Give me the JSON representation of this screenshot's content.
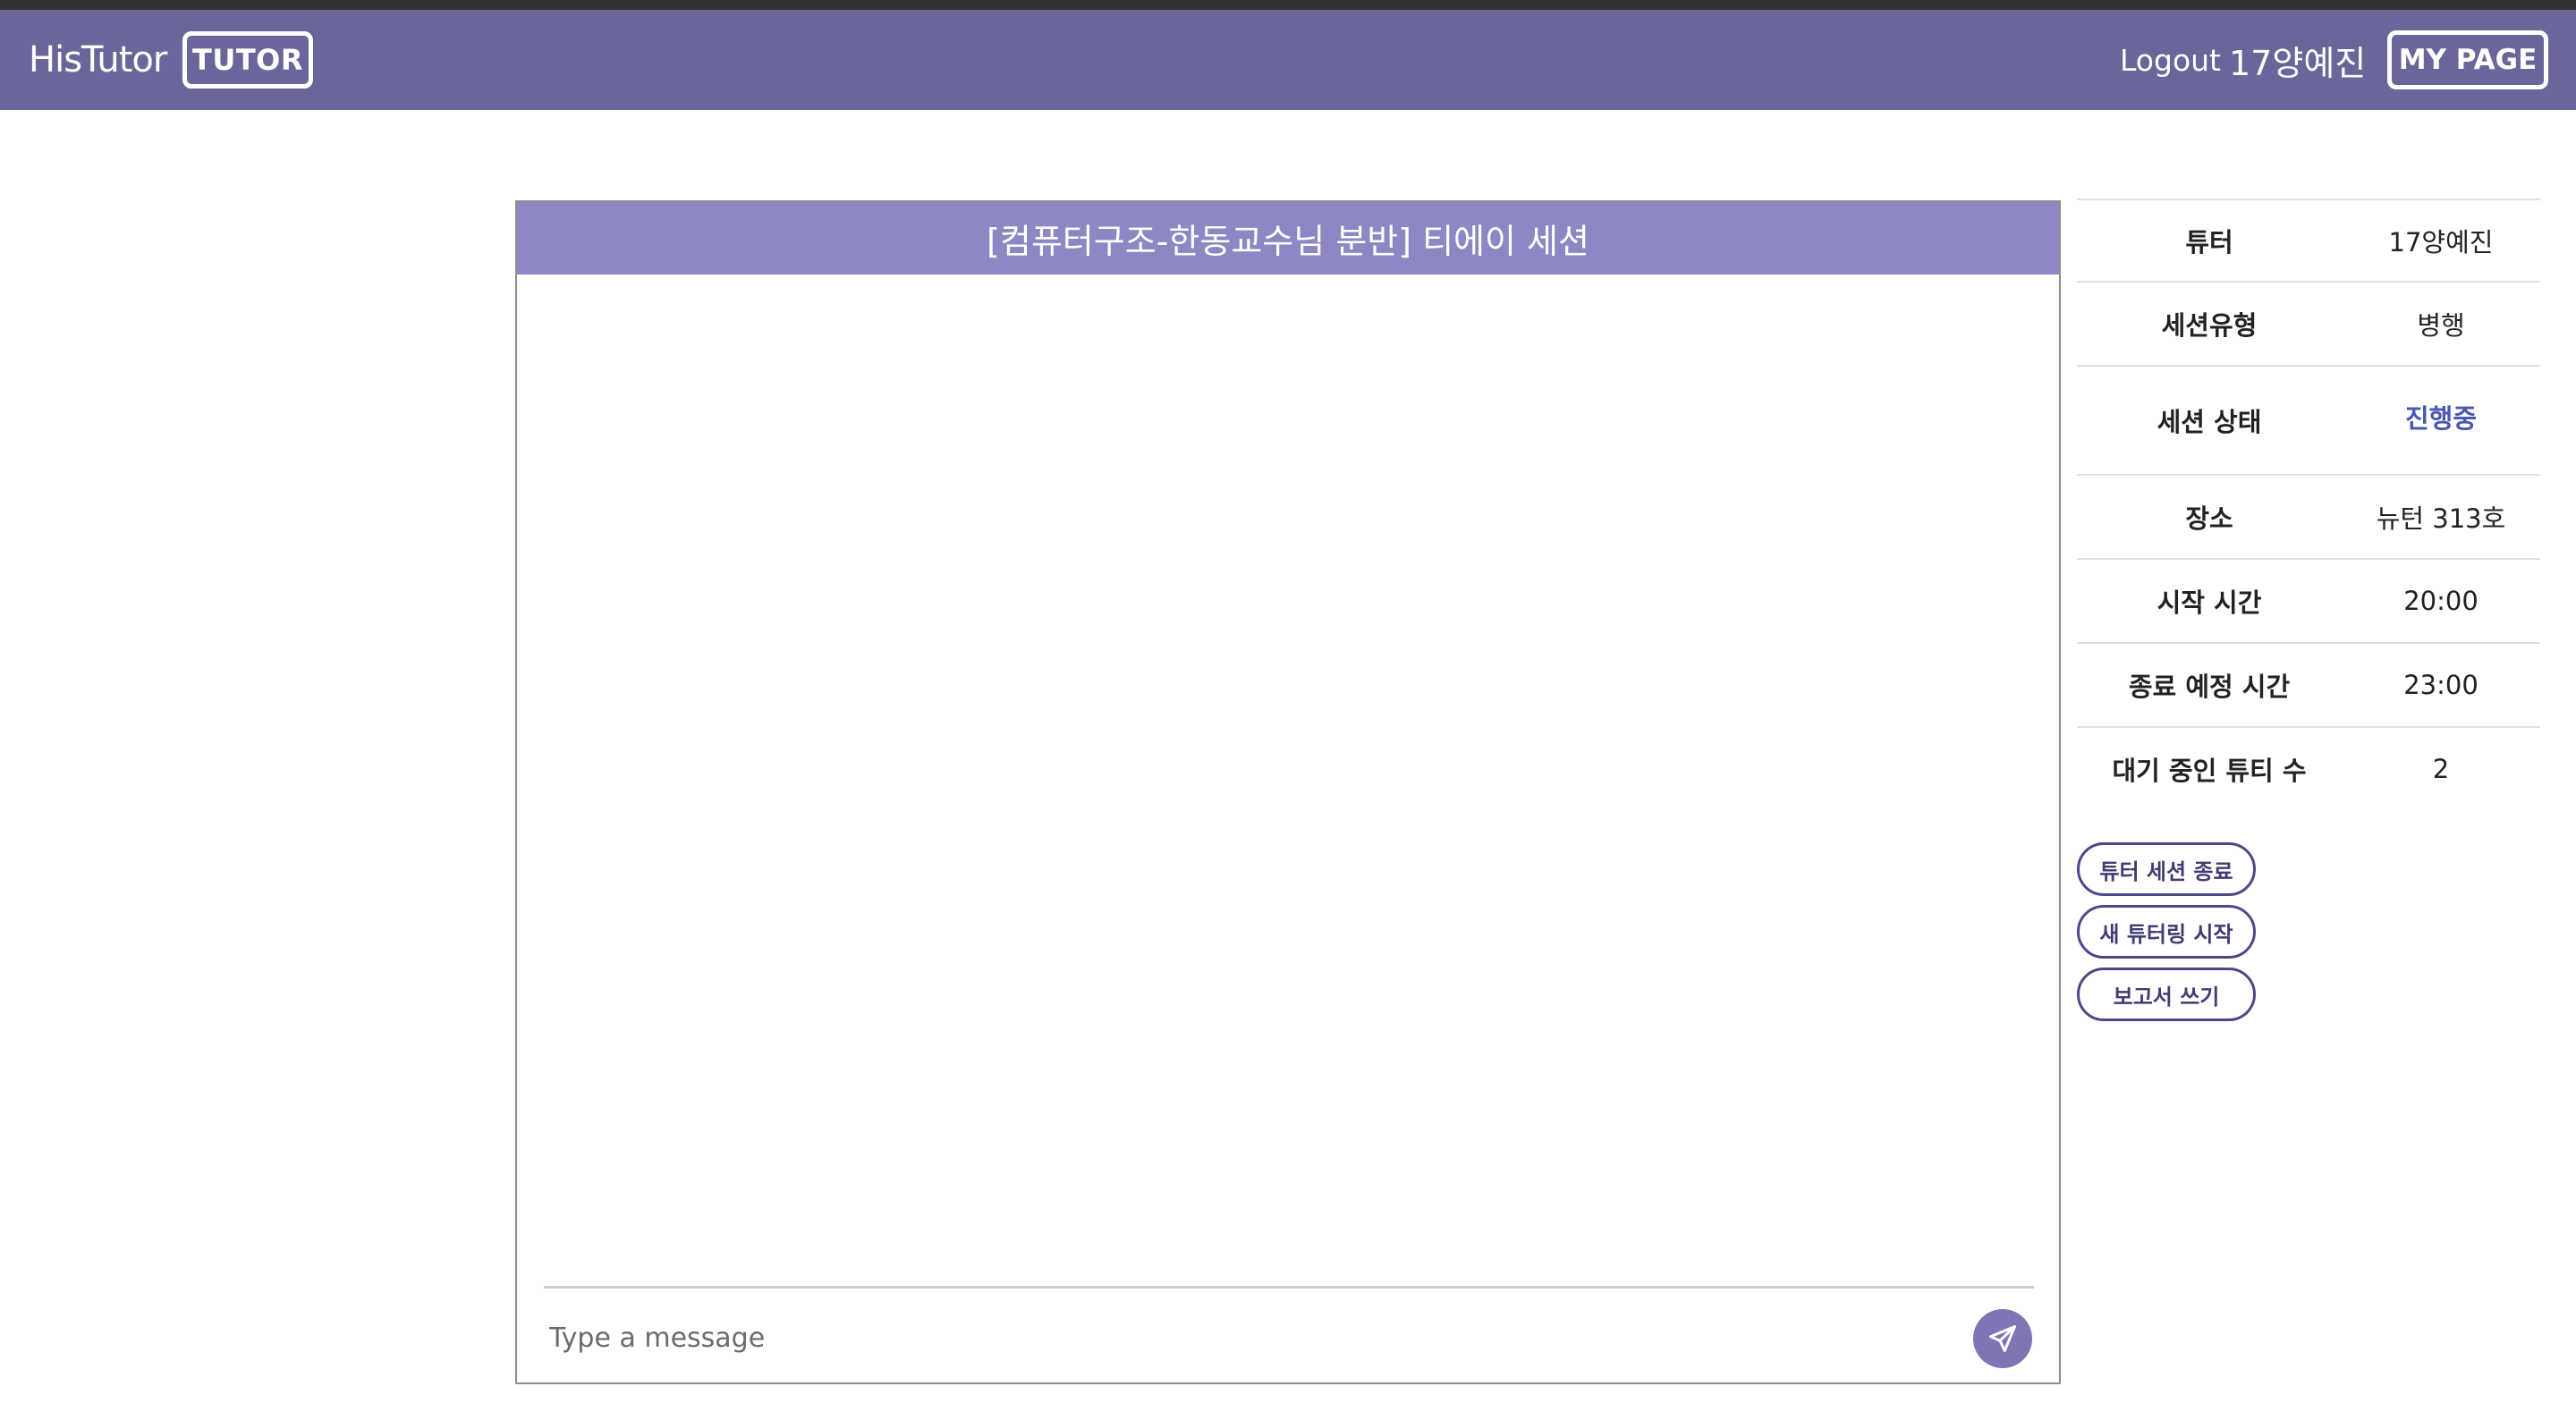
{
  "navbar": {
    "brand": "HisTutor",
    "role_badge": "TUTOR",
    "logout": "Logout",
    "username": "17양예진",
    "mypage": "MY PAGE",
    "bg_color": "#6a6699"
  },
  "chat": {
    "title": "[컴퓨터구조-한동교수님 분반] 티에이 세션",
    "input_placeholder": "Type a message",
    "input_value": "",
    "send_icon": "paper-plane-icon"
  },
  "session_info": {
    "rows": [
      {
        "label": "튜터",
        "value": "17양예진"
      },
      {
        "label": "세션유형",
        "value": "병행"
      },
      {
        "label": "세션 상태",
        "value": "진행중"
      },
      {
        "label": "장소",
        "value": "뉴턴 313호"
      },
      {
        "label": "시작 시간",
        "value": "20:00"
      },
      {
        "label": "종료 예정 시간",
        "value": "23:00"
      },
      {
        "label": "대기 중인 튜티 수",
        "value": "2"
      }
    ],
    "status_color": "#4b57b0"
  },
  "actions": {
    "end_session": "튜터 세션 종료",
    "new_tutoring": "새 튜터링 시작",
    "write_report": "보고서 쓰기"
  }
}
